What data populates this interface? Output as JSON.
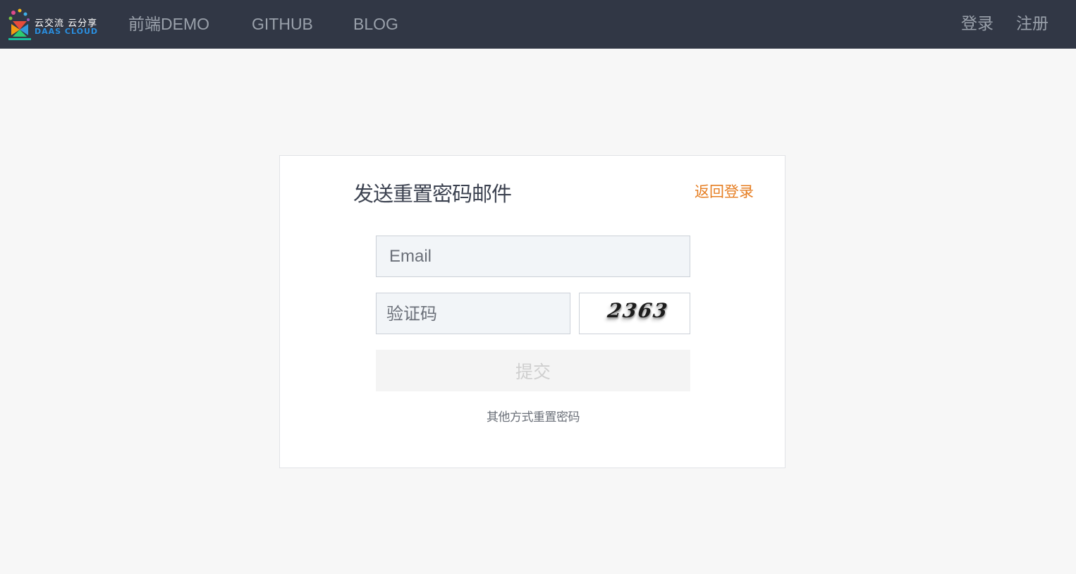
{
  "header": {
    "logo": {
      "slogan": "云交流 云分享",
      "brand": "DAAS CLOUD"
    },
    "nav": [
      {
        "label": "前端DEMO"
      },
      {
        "label": "GITHUB"
      },
      {
        "label": "BLOG"
      }
    ],
    "auth": {
      "login_label": "登录",
      "register_label": "注册"
    }
  },
  "form": {
    "title": "发送重置密码邮件",
    "back_label": "返回登录",
    "email_placeholder": "Email",
    "captcha_placeholder": "验证码",
    "captcha_code": "2363",
    "submit_label": "提交",
    "other_label": "其他方式重置密码"
  },
  "colors": {
    "navbar_bg": "#313745",
    "accent": "#e67e22",
    "page_bg": "#f7f7f7"
  }
}
